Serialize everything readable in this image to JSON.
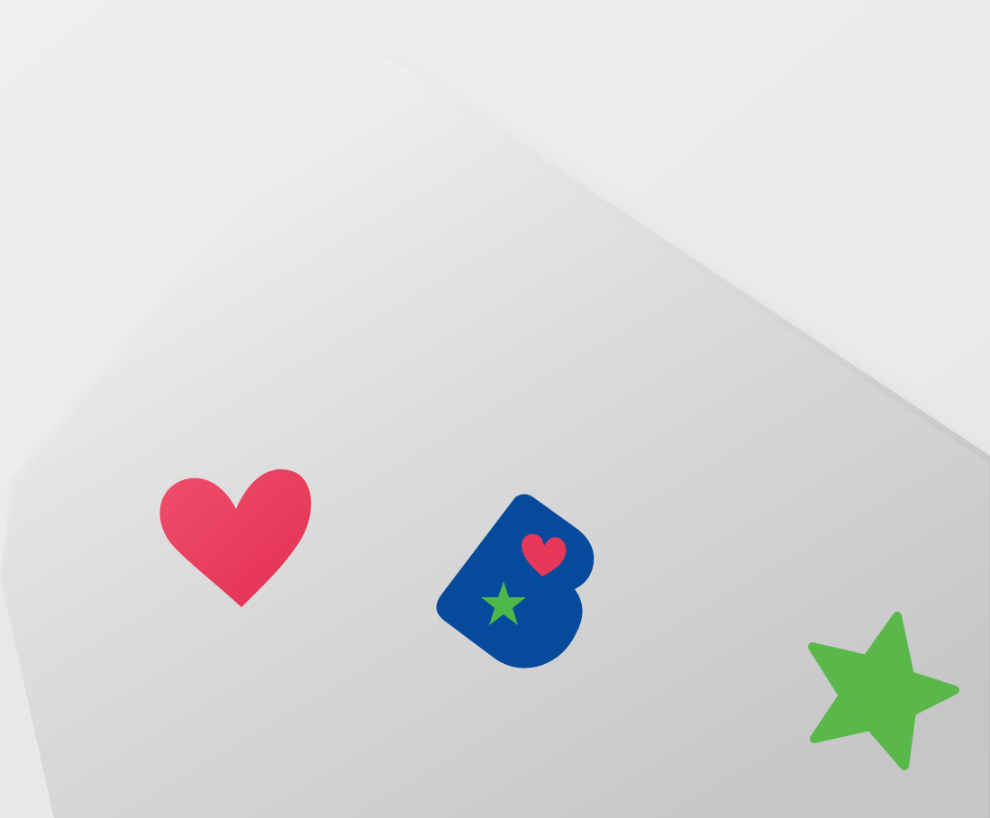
{
  "scene": {
    "description_free": true,
    "colors": {
      "background": "#eeeeee",
      "laptop_body": "#d9d9da",
      "laptop_highlight": "#f6f6f6",
      "laptop_shadow": "#bdbdbf",
      "heart_sticker": "#e8385a",
      "logo_blue": "#064a9c",
      "logo_heart": "#e8385a",
      "logo_star": "#4db748",
      "star_sticker": "#5ab84a"
    },
    "icons": {
      "heart_sticker": "heart-icon",
      "logo_sticker": "b-logo-icon",
      "star_sticker": "star-icon"
    }
  }
}
